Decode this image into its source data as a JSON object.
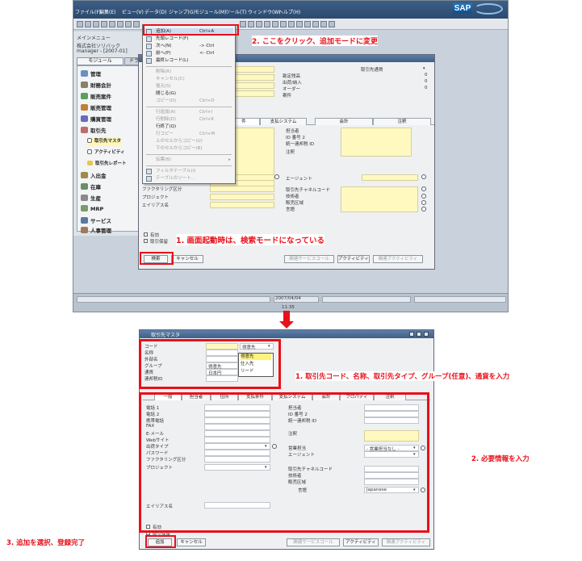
{
  "top": {
    "menu": [
      "ファイル(F)",
      "編集(E)",
      "ビュー(V)",
      "データ(D)",
      "ジャンプ(G)",
      "モジュール(M)",
      "ツール(T)",
      "ウィンドウ(W)",
      "ヘルプ(H)"
    ],
    "logo": "SAP",
    "panel": {
      "company": "メインメニュー",
      "company_name": "株式会社ソリバック",
      "user": "manager - [2007-01]",
      "tab_modules": "モジュール",
      "tab_other": "ドラ",
      "modules": [
        "管理",
        "財務会計",
        "販売案件",
        "販売管理",
        "購買管理",
        "取引先",
        "取引先マスタ",
        "アクティビティ",
        "取引先レポート",
        "入出金",
        "在庫",
        "生産",
        "MRP",
        "サービス",
        "人事管理"
      ]
    },
    "dropdown": {
      "items": [
        {
          "label": "追加(A)",
          "shortcut": "Ctrl+A"
        },
        {
          "label": "先頭レコード(F)",
          "shortcut": ""
        },
        {
          "label": "次へ(N)",
          "shortcut": "-> Ctrl"
        },
        {
          "label": "前へ(P)",
          "shortcut": "<- Ctrl"
        },
        {
          "label": "最終レコード(L)",
          "shortcut": ""
        },
        {
          "label": "削除(R)",
          "shortcut": ""
        },
        {
          "label": "キャンセル(C)",
          "shortcut": ""
        },
        {
          "label": "復元(S)",
          "shortcut": ""
        },
        {
          "label": "閉じる(G)",
          "shortcut": ""
        },
        {
          "label": "コピー(O)",
          "shortcut": "Ctrl+D"
        },
        {
          "label": "行追加(A)",
          "shortcut": "Ctrl+I"
        },
        {
          "label": "行削除(D)",
          "shortcut": "Ctrl+K"
        },
        {
          "label": "行終了(Q)",
          "shortcut": ""
        },
        {
          "label": "行コピー",
          "shortcut": "Ctrl+M"
        },
        {
          "label": "上のセルからコピー(U)",
          "shortcut": ""
        },
        {
          "label": "下のセルからコピー(B)",
          "shortcut": ""
        },
        {
          "label": "伝票(B)",
          "shortcut": ""
        },
        {
          "label": "フィルタテーブル(I)",
          "shortcut": ""
        },
        {
          "label": "テーブルのソート...",
          "shortcut": ""
        }
      ]
    },
    "form": {
      "right_labels": [
        "勘定残高",
        "出荷/納入",
        "オーダー",
        "案件"
      ],
      "currency_label": "取引先通貨",
      "zeros": [
        "0",
        "0",
        "0"
      ],
      "tabs": [
        "件",
        "支払システム",
        "会計",
        "注釈"
      ],
      "contact_labels": [
        "担当者",
        "ID 番号 2",
        "統一連邦税 ID",
        "注釈"
      ],
      "lower_left_labels": [
        "ファクタリング区分",
        "プロジェクト",
        "エイリアス名"
      ],
      "agent_label": "エージェント",
      "lower_right_labels": [
        "取引先チャネルコード",
        "技術者",
        "販売区域",
        "言語"
      ],
      "checkboxes": [
        "有効",
        "取引保留"
      ],
      "buttons": {
        "search": "検索",
        "cancel": "キャンセル",
        "related_service": "関連サービスコール",
        "activity": "アクティビティ",
        "related_activity": "関連アクティビティ"
      }
    },
    "status": {
      "date": "2007/04/04",
      "time": "11:35"
    }
  },
  "annotations": {
    "top_click": "2. ここをクリック、追加モードに変更",
    "top_search_mode": "1. 画面起動時は、検索モードになっている",
    "bottom_enter_code": "1. 取引先コード、名称、取引先タイプ、グループ(任意)、通貨を入力",
    "bottom_enter_info": "2. 必要情報を入力",
    "bottom_add": "3. 追加を選択、登録完了"
  },
  "bottom": {
    "title": "取引先マスタ",
    "header_labels": [
      "コード",
      "名称",
      "外部名",
      "グループ",
      "通貨",
      "連邦税ID"
    ],
    "type_value": "得意先",
    "group_value": "得意先",
    "currency_value": "日本円",
    "type_options": [
      "得意先",
      "仕入先",
      "リード"
    ],
    "tabs": [
      "一般",
      "担当者",
      "住所",
      "支払条件",
      "支払システム",
      "会計",
      "プロパティ",
      "注釈"
    ],
    "left_labels": [
      "電話 1",
      "電話 2",
      "携帯電話",
      "FAX",
      "E-メール",
      "Webサイト",
      "出荷タイプ",
      "パスワード",
      "ファクタリング区分",
      "プロジェクト"
    ],
    "right_labels": [
      "担当者",
      "ID 番号 2",
      "統一連邦税 ID",
      "注釈",
      "営業担当",
      "エージェント",
      "取引先チャネルコード",
      "技術者",
      "販売区域",
      "言語"
    ],
    "sales_value": "- 営業担当なし -",
    "language_value": "Japanese",
    "alias_label": "エイリアス名",
    "checkboxes": [
      "有効",
      "取引保留"
    ],
    "buttons": {
      "add": "追加",
      "cancel": "キャンセル",
      "related_service": "関連サービスコール",
      "activity": "アクティビティ",
      "related_activity": "関連アクティビティ"
    }
  }
}
